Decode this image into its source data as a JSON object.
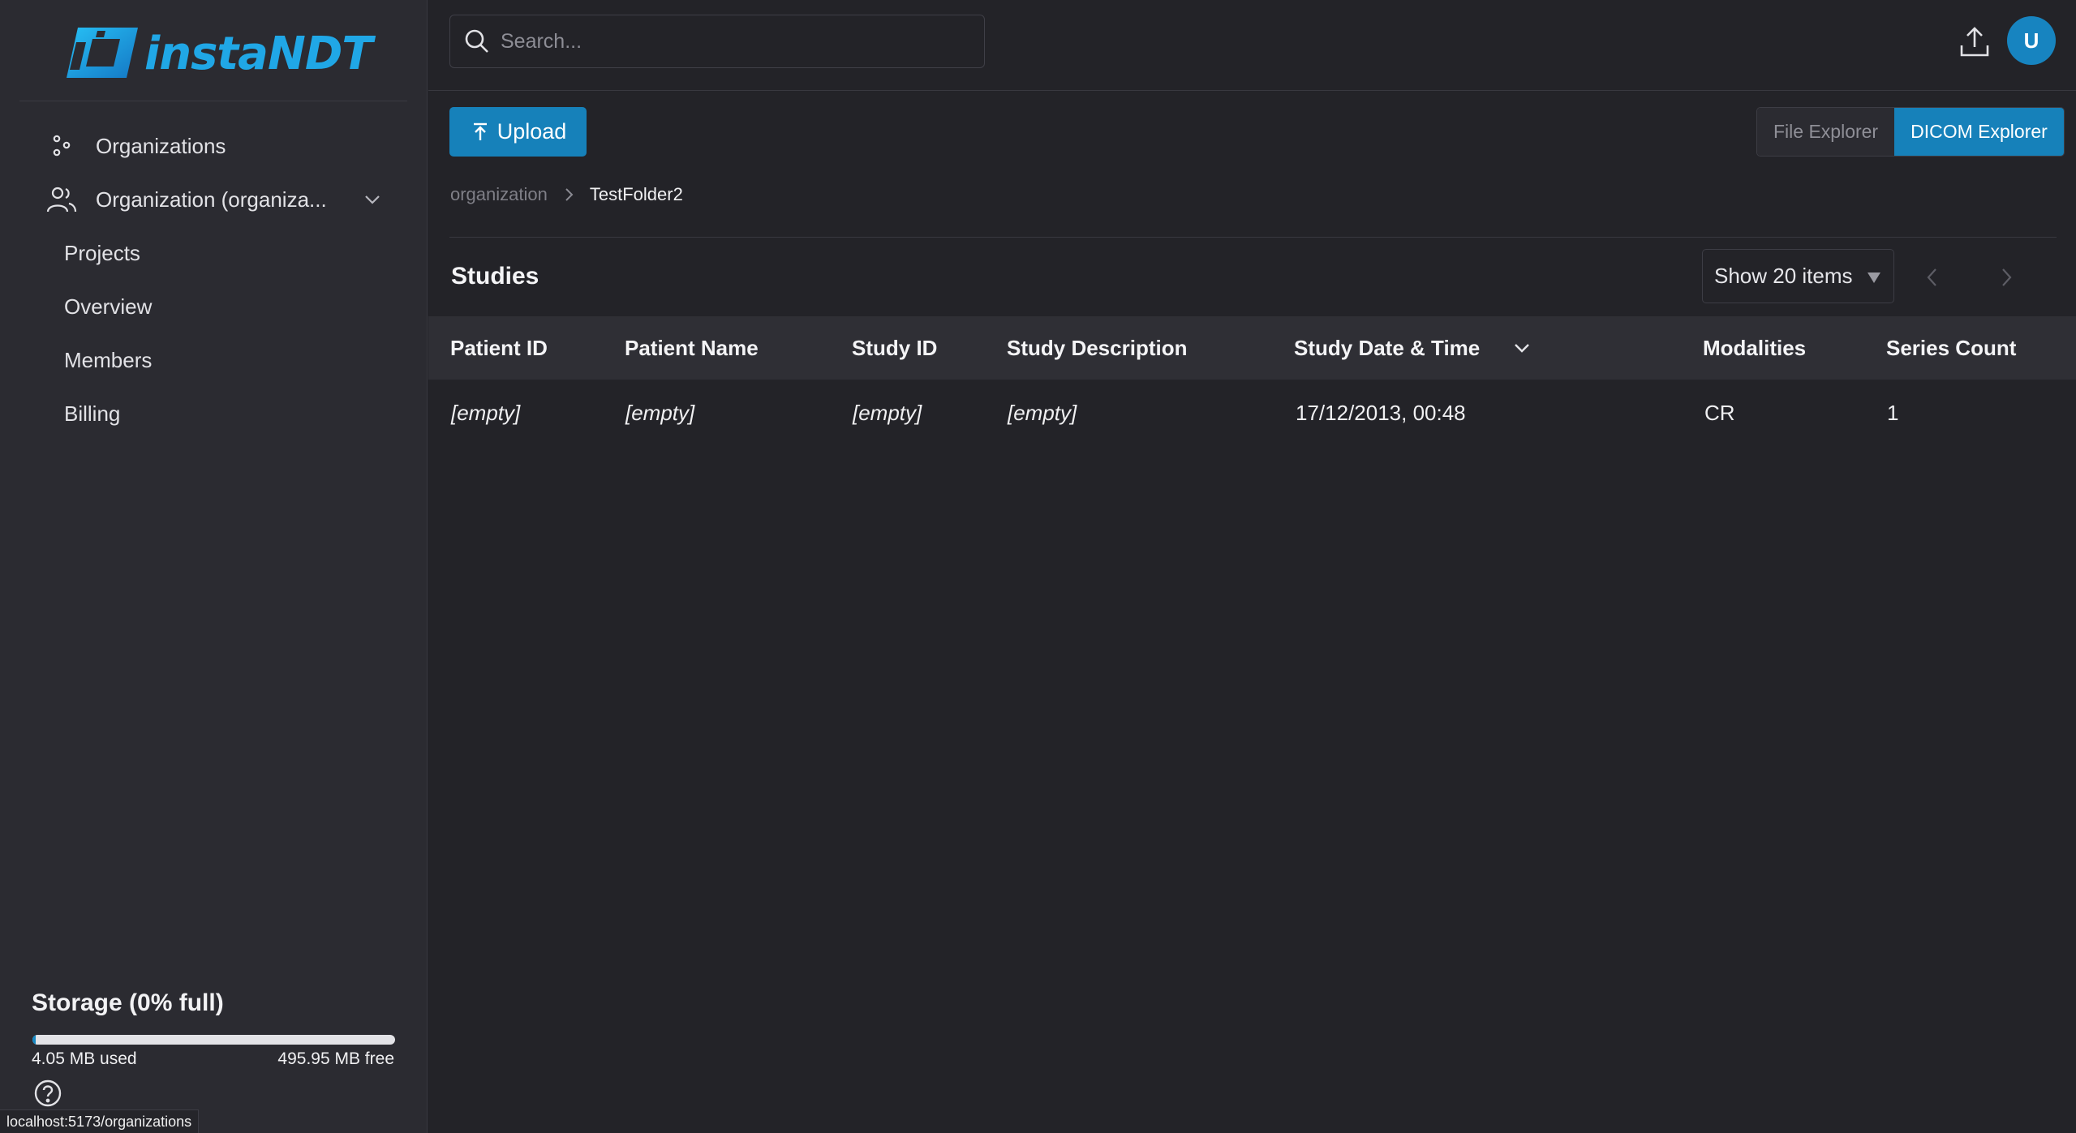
{
  "brand": {
    "logo_text": "instaNDT",
    "accent": "#1681ba",
    "logo_color": "#20a7e6"
  },
  "sidebar": {
    "items": [
      {
        "label": "Organizations",
        "icon": "organizations-icon"
      },
      {
        "label": "Organization (organiza...",
        "icon": "users-icon",
        "expandable": true
      }
    ],
    "sub_items": [
      {
        "label": "Projects"
      },
      {
        "label": "Overview"
      },
      {
        "label": "Members"
      },
      {
        "label": "Billing"
      }
    ],
    "storage": {
      "title": "Storage (0% full)",
      "used": "4.05 MB used",
      "free": "495.95 MB free",
      "fraction_used": 0.0081
    },
    "status_url": "localhost:5173/organizations"
  },
  "header": {
    "search_placeholder": "Search...",
    "avatar_initial": "U"
  },
  "toolbar": {
    "upload_label": "Upload",
    "views": [
      {
        "label": "File Explorer",
        "active": false
      },
      {
        "label": "DICOM Explorer",
        "active": true
      }
    ]
  },
  "breadcrumb": {
    "root": "organization",
    "current": "TestFolder2"
  },
  "studies": {
    "title": "Studies",
    "page_size_label": "Show 20 items",
    "columns": [
      "Patient ID",
      "Patient Name",
      "Study ID",
      "Study Description",
      "Study Date & Time",
      "Modalities",
      "Series Count"
    ],
    "sorted_column": "Study Date & Time",
    "rows": [
      {
        "patient_id": "[empty]",
        "patient_name": "[empty]",
        "study_id": "[empty]",
        "study_description": "[empty]",
        "study_datetime": "17/12/2013, 00:48",
        "modalities": "CR",
        "series_count": "1"
      }
    ]
  }
}
